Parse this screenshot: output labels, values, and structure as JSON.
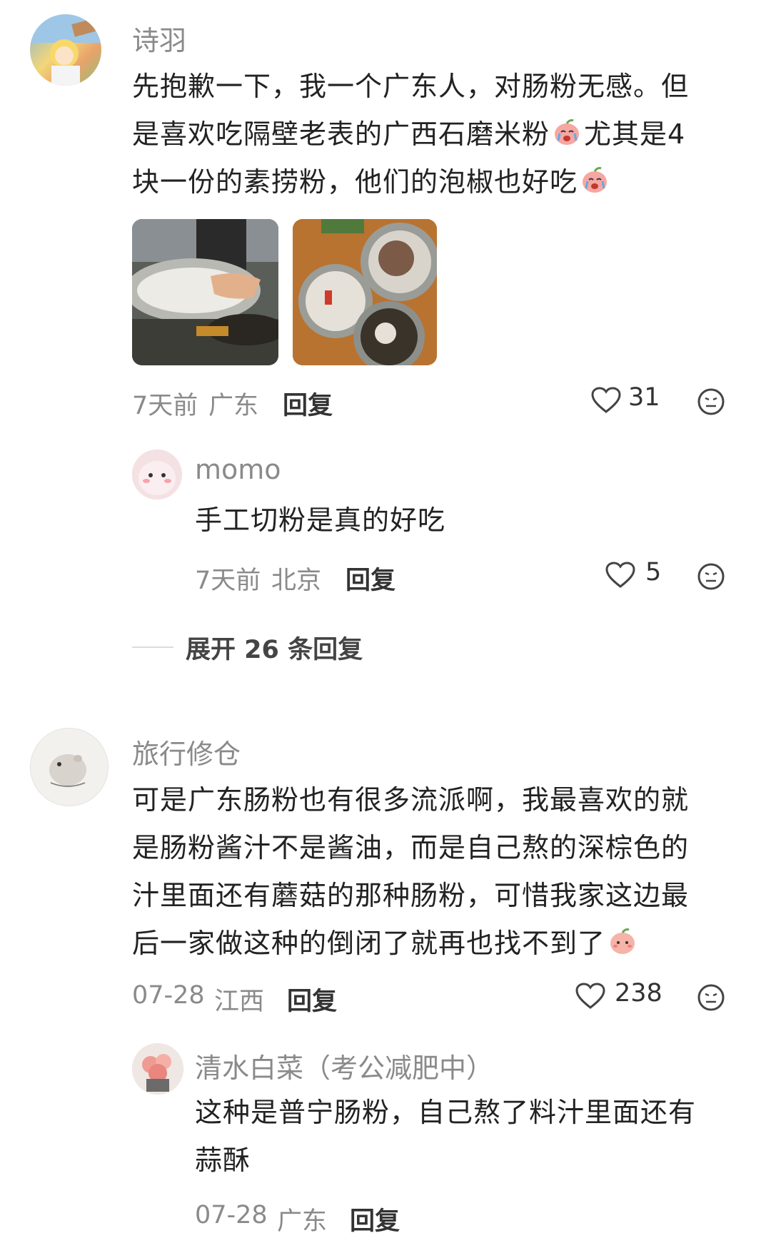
{
  "comments": [
    {
      "name": "诗羽",
      "lines": [
        "先抱歉一下，我一个广东人，对肠粉无感。但",
        "是喜欢吃隔壁老表的广西石磨米粉",
        "尤其是4",
        "块一份的素捞粉，他们的泡椒也好吃"
      ],
      "time": "7天前",
      "location": "广东",
      "reply_label": "回复",
      "likes": "31",
      "replies": [
        {
          "name": "momo",
          "text": "手工切粉是真的好吃",
          "time": "7天前",
          "location": "北京",
          "reply_label": "回复",
          "likes": "5"
        }
      ],
      "expand_label": "展开 26 条回复"
    },
    {
      "name": "旅行修仓",
      "lines": [
        "可是广东肠粉也有很多流派啊，我最喜欢的就",
        "是肠粉酱汁不是酱油，而是自己熬的深棕色的",
        "汁里面还有蘑菇的那种肠粉，可惜我家这边最",
        "后一家做这种的倒闭了就再也找不到了"
      ],
      "time": "07-28",
      "location": "江西",
      "reply_label": "回复",
      "likes": "238",
      "replies": [
        {
          "name": "清水白菜（考公减肥中）",
          "lines": [
            "这种是普宁肠粉，自己熬了料汁里面还有",
            "蒜酥"
          ],
          "time": "07-28",
          "location": "广东",
          "reply_label": "回复"
        }
      ]
    }
  ],
  "icons": {
    "heart": "heart-icon",
    "emoji": "neutral-face-icon",
    "crying_emoji": "crying-peach-emoji",
    "smile_emoji": "peach-emoji"
  },
  "colors": {
    "name": "#8a8a8a",
    "text": "#222222",
    "meta": "#8a8a8a"
  }
}
